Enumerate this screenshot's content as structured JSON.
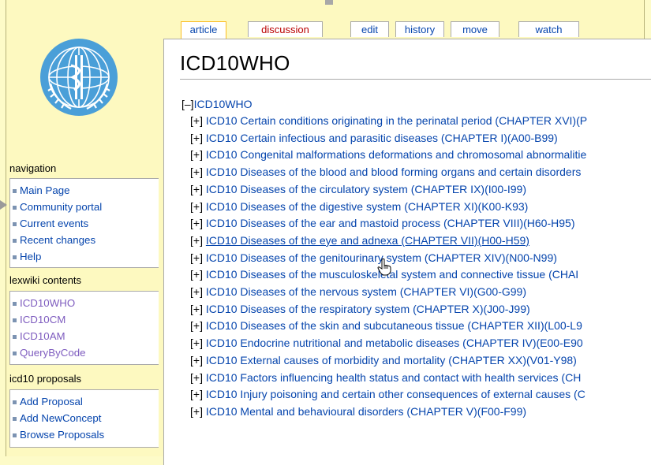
{
  "tabs": [
    {
      "label": "article"
    },
    {
      "label": "discussion"
    },
    {
      "label": "edit"
    },
    {
      "label": "history"
    },
    {
      "label": "move"
    },
    {
      "label": "watch"
    }
  ],
  "page": {
    "title": "ICD10WHO"
  },
  "tree": {
    "root": {
      "toggle": "[–]",
      "label": "ICD10WHO"
    },
    "children": [
      {
        "toggle": "[+]",
        "label": "ICD10 Certain conditions originating in the perinatal period (CHAPTER XVI)(P"
      },
      {
        "toggle": "[+]",
        "label": "ICD10 Certain infectious and parasitic diseases (CHAPTER I)(A00-B99)"
      },
      {
        "toggle": "[+]",
        "label": "ICD10 Congenital malformations deformations and chromosomal abnormalitie"
      },
      {
        "toggle": "[+]",
        "label": "ICD10 Diseases of the blood and blood forming organs and certain disorders"
      },
      {
        "toggle": "[+]",
        "label": "ICD10 Diseases of the circulatory system (CHAPTER IX)(I00-I99)"
      },
      {
        "toggle": "[+]",
        "label": "ICD10 Diseases of the digestive system (CHAPTER XI)(K00-K93)"
      },
      {
        "toggle": "[+]",
        "label": "ICD10 Diseases of the ear and mastoid process (CHAPTER VIII)(H60-H95)"
      },
      {
        "toggle": "[+]",
        "label": "ICD10 Diseases of the eye and adnexa (CHAPTER VII)(H00-H59)"
      },
      {
        "toggle": "[+]",
        "label": "ICD10 Diseases of the genitourinary system (CHAPTER XIV)(N00-N99)"
      },
      {
        "toggle": "[+]",
        "label": "ICD10 Diseases of the musculoskeletal system and connective tissue (CHAI"
      },
      {
        "toggle": "[+]",
        "label": "ICD10 Diseases of the nervous system (CHAPTER VI)(G00-G99)"
      },
      {
        "toggle": "[+]",
        "label": "ICD10 Diseases of the respiratory system (CHAPTER X)(J00-J99)"
      },
      {
        "toggle": "[+]",
        "label": "ICD10 Diseases of the skin and subcutaneous tissue (CHAPTER XII)(L00-L9"
      },
      {
        "toggle": "[+]",
        "label": "ICD10 Endocrine nutritional and metabolic diseases (CHAPTER IV)(E00-E90"
      },
      {
        "toggle": "[+]",
        "label": "ICD10 External causes of morbidity and mortality (CHAPTER XX)(V01-Y98)"
      },
      {
        "toggle": "[+]",
        "label": "ICD10 Factors influencing health status and contact with health services (CH"
      },
      {
        "toggle": "[+]",
        "label": "ICD10 Injury poisoning and certain other consequences of external causes (C"
      },
      {
        "toggle": "[+]",
        "label": "ICD10 Mental and behavioural disorders (CHAPTER V)(F00-F99)"
      }
    ]
  },
  "sidebar": {
    "navigation": {
      "title": "navigation",
      "items": [
        {
          "label": "Main Page"
        },
        {
          "label": "Community portal"
        },
        {
          "label": "Current events"
        },
        {
          "label": "Recent changes"
        },
        {
          "label": "Help"
        }
      ]
    },
    "lexwiki": {
      "title": "lexwiki contents",
      "items": [
        {
          "label": "ICD10WHO"
        },
        {
          "label": "ICD10CM"
        },
        {
          "label": "ICD10AM"
        },
        {
          "label": "QueryByCode"
        }
      ]
    },
    "proposals": {
      "title": "icd10 proposals",
      "items": [
        {
          "label": "Add Proposal"
        },
        {
          "label": "Add NewConcept"
        },
        {
          "label": "Browse Proposals"
        }
      ]
    }
  },
  "colors": {
    "page_background": "#fdfbc8",
    "link": "#0645ad",
    "visited_link": "#7e5cbf",
    "new_link": "#ba0000",
    "selected_tab_border": "#fabd23",
    "logo_blue": "#4a9fd8"
  },
  "icons": {
    "logo": "who-emblem-icon",
    "cursor": "hand-pointer-icon",
    "arrow": "arrow-right-icon"
  }
}
